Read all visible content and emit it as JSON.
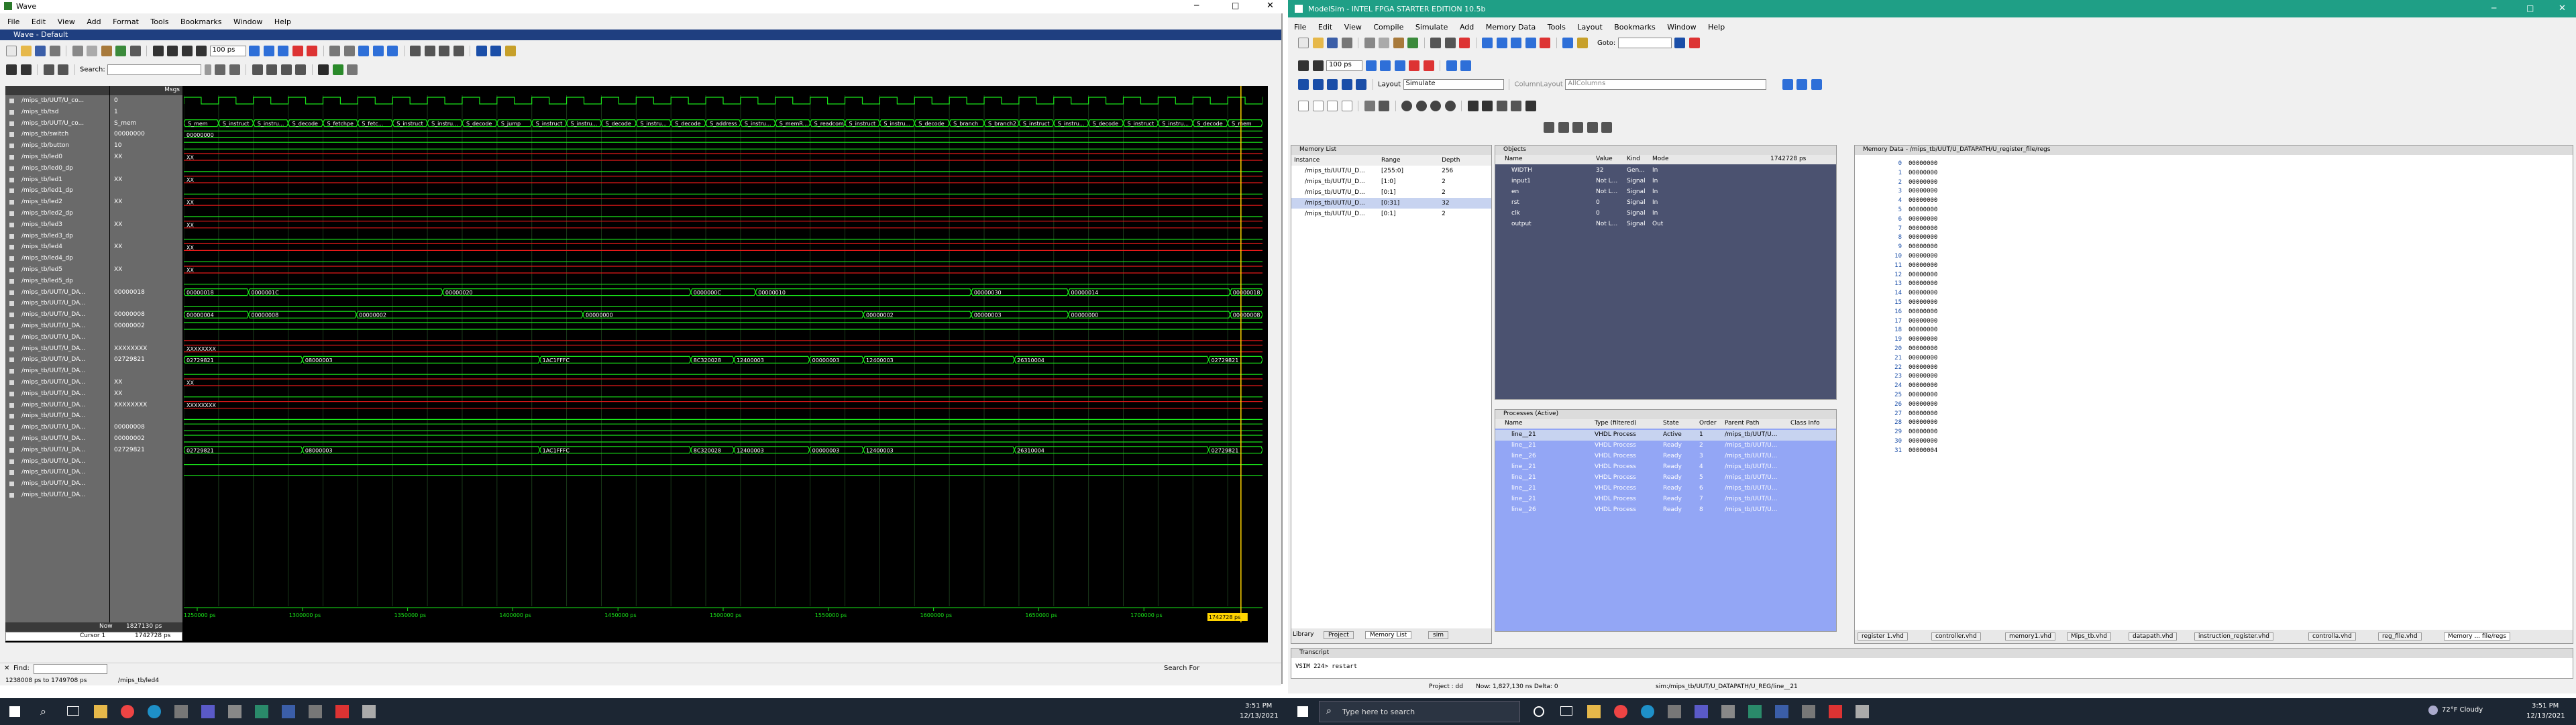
{
  "wave": {
    "title": "Wave",
    "menu": [
      "File",
      "Edit",
      "View",
      "Add",
      "Format",
      "Tools",
      "Bookmarks",
      "Window",
      "Help"
    ],
    "subtitle": "Wave - Default",
    "search_label": "Search:",
    "header_msgs": "Msgs",
    "time_field": "100 ps",
    "signals": [
      "/mips_tb/UUT/U_co...",
      "/mips_tb/tsd",
      "/mips_tb/UUT/U_co...",
      "/mips_tb/switch",
      "/mips_tb/button",
      "/mips_tb/led0",
      "/mips_tb/led0_dp",
      "/mips_tb/led1",
      "/mips_tb/led1_dp",
      "/mips_tb/led2",
      "/mips_tb/led2_dp",
      "/mips_tb/led3",
      "/mips_tb/led3_dp",
      "/mips_tb/led4",
      "/mips_tb/led4_dp",
      "/mips_tb/led5",
      "/mips_tb/led5_dp",
      "/mips_tb/UUT/U_DA...",
      "/mips_tb/UUT/U_DA...",
      "/mips_tb/UUT/U_DA...",
      "/mips_tb/UUT/U_DA...",
      "/mips_tb/UUT/U_DA...",
      "/mips_tb/UUT/U_DA...",
      "/mips_tb/UUT/U_DA...",
      "/mips_tb/UUT/U_DA...",
      "/mips_tb/UUT/U_DA...",
      "/mips_tb/UUT/U_DA...",
      "/mips_tb/UUT/U_DA...",
      "/mips_tb/UUT/U_DA...",
      "/mips_tb/UUT/U_DA...",
      "/mips_tb/UUT/U_DA...",
      "/mips_tb/UUT/U_DA...",
      "/mips_tb/UUT/U_DA...",
      "/mips_tb/UUT/U_DA...",
      "/mips_tb/UUT/U_DA...",
      "/mips_tb/UUT/U_DA..."
    ],
    "values": [
      "0",
      "1",
      "S_mem",
      "00000000",
      "10",
      "XX",
      "",
      "XX",
      "",
      "XX",
      "",
      "XX",
      "",
      "XX",
      "",
      "XX",
      "",
      "00000018",
      "",
      "00000008",
      "00000002",
      "",
      "XXXXXXXX",
      "02729821",
      "",
      "XX",
      "XX",
      "XXXXXXXX",
      "",
      "00000008",
      "00000002",
      "02729821",
      "",
      "",
      "",
      ""
    ],
    "state_labels": [
      "S_mem",
      "S_instruct",
      "S_instru...",
      "S_decode",
      "S_fetchpe",
      "S_fetc...",
      "S_instruct",
      "S_instru...",
      "S_decode",
      "S_jump",
      "S_instruct",
      "S_instru...",
      "S_decode",
      "S_instru...",
      "S_decode",
      "S_address",
      "S_instru...",
      "S_memR...",
      "S_readcom",
      "S_instruct",
      "S_instru...",
      "S_decode",
      "S_branch",
      "S_branch2",
      "S_instruct",
      "S_instru...",
      "S_decode",
      "S_instruct",
      "S_instru...",
      "S_decode",
      "S_mem"
    ],
    "bus1": [
      "00000018",
      "0000001C",
      "00000020",
      "0000000C",
      "00000010",
      "00000030",
      "00000014",
      "00000018"
    ],
    "bus2": [
      "00000004",
      "00000008",
      "00000002",
      "00000000",
      "00000002",
      "00000003",
      "00000000",
      "00000008"
    ],
    "bus3": [
      "02729821",
      "08000003",
      "1AC1FFFC",
      "8C320028",
      "12400003",
      "00000003",
      "12400003",
      "26310004",
      "02729821"
    ],
    "bus4": [
      "02729821",
      "08000003",
      "1AC1FFFC",
      "8C320028",
      "12400003",
      "00000003",
      "12400003",
      "26310004",
      "02729821"
    ],
    "now_label": "Now",
    "now_value": "1827130 ps",
    "cursor_label": "Cursor 1",
    "cursor_value": "1742728 ps",
    "ticks": [
      "1250000 ps",
      "1300000 ps",
      "1350000 ps",
      "1400000 ps",
      "1450000 ps",
      "1500000 ps",
      "1550000 ps",
      "1600000 ps",
      "1650000 ps",
      "1700000 ps"
    ],
    "cursor_flag": "1742728 ps",
    "status_range": "1238008 ps to 1749708 ps",
    "status_signal": "/mips_tb/led4",
    "find_label": "Find:",
    "search_for": "Search For"
  },
  "msim": {
    "title": "ModelSim - INTEL FPGA STARTER EDITION 10.5b",
    "menu": [
      "File",
      "Edit",
      "View",
      "Compile",
      "Simulate",
      "Add",
      "Memory Data",
      "Tools",
      "Layout",
      "Bookmarks",
      "Window",
      "Help"
    ],
    "goto_label": "Goto:",
    "layout_label": "Layout",
    "layout_value": "Simulate",
    "column_layout_label": "ColumnLayout",
    "column_layout_value": "AllColumns",
    "time_field": "100 ps",
    "memlist": {
      "title": "Memory List",
      "headers": [
        "Instance",
        "Range",
        "Depth"
      ],
      "rows": [
        [
          "/mips_tb/UUT/U_D...",
          "[255:0]",
          "256"
        ],
        [
          "/mips_tb/UUT/U_D...",
          "[1:0]",
          "2"
        ],
        [
          "/mips_tb/UUT/U_D...",
          "[0:1]",
          "2"
        ],
        [
          "/mips_tb/UUT/U_D...",
          "[0:31]",
          "32"
        ],
        [
          "/mips_tb/UUT/U_D...",
          "[0:1]",
          "2"
        ]
      ],
      "tabs": [
        "Library",
        "Project",
        "Memory List",
        "sim"
      ]
    },
    "objects": {
      "title": "Objects",
      "headers": [
        "Name",
        "Value",
        "Kind",
        "Mode"
      ],
      "time_label": "1742728 ps",
      "rows": [
        [
          "WIDTH",
          "32",
          "Gen...",
          "In"
        ],
        [
          "input1",
          "Not L...",
          "Signal",
          "In"
        ],
        [
          "en",
          "Not L...",
          "Signal",
          "In"
        ],
        [
          "rst",
          "0",
          "Signal",
          "In"
        ],
        [
          "clk",
          "0",
          "Signal",
          "In"
        ],
        [
          "output",
          "Not L...",
          "Signal",
          "Out"
        ]
      ]
    },
    "processes": {
      "title": "Processes (Active)",
      "headers": [
        "Name",
        "Type (filtered)",
        "State",
        "Order",
        "Parent Path",
        "Class Info"
      ],
      "rows": [
        [
          "line__21",
          "VHDL Process",
          "Active",
          "1",
          "/mips_tb/UUT/U..."
        ],
        [
          "line__21",
          "VHDL Process",
          "Ready",
          "2",
          "/mips_tb/UUT/U..."
        ],
        [
          "line__26",
          "VHDL Process",
          "Ready",
          "3",
          "/mips_tb/UUT/U..."
        ],
        [
          "line__21",
          "VHDL Process",
          "Ready",
          "4",
          "/mips_tb/UUT/U..."
        ],
        [
          "line__21",
          "VHDL Process",
          "Ready",
          "5",
          "/mips_tb/UUT/U..."
        ],
        [
          "line__21",
          "VHDL Process",
          "Ready",
          "6",
          "/mips_tb/UUT/U..."
        ],
        [
          "line__21",
          "VHDL Process",
          "Ready",
          "7",
          "/mips_tb/UUT/U..."
        ],
        [
          "line__26",
          "VHDL Process",
          "Ready",
          "8",
          "/mips_tb/UUT/U..."
        ]
      ]
    },
    "memdata": {
      "title": "Memory Data - /mips_tb/UUT/U_DATAPATH/U_register_file/regs",
      "addresses": [
        "0",
        "1",
        "2",
        "3",
        "4",
        "5",
        "6",
        "7",
        "8",
        "9",
        "10",
        "11",
        "12",
        "13",
        "14",
        "15",
        "16",
        "17",
        "18",
        "19",
        "20",
        "21",
        "22",
        "23",
        "24",
        "25",
        "26",
        "27",
        "28",
        "29",
        "30",
        "31"
      ],
      "values": [
        "00000000",
        "00000000",
        "00000000",
        "00000000",
        "00000000",
        "00000000",
        "00000000",
        "00000000",
        "00000000",
        "00000000",
        "00000000",
        "00000000",
        "00000000",
        "00000000",
        "00000000",
        "00000000",
        "00000000",
        "00000000",
        "00000000",
        "00000000",
        "00000000",
        "00000000",
        "00000000",
        "00000000",
        "00000000",
        "00000000",
        "00000000",
        "00000000",
        "00000000",
        "00000000",
        "00000000",
        "00000004"
      ],
      "tabs": [
        "register 1.vhd",
        "controller.vhd",
        "memory1.vhd",
        "Mips_tb.vhd",
        "datapath.vhd",
        "instruction_register.vhd",
        "controlla.vhd",
        "reg_file.vhd",
        "Memory ... file/regs"
      ]
    },
    "transcript": {
      "title": "Transcript",
      "line": "VSIM 224> restart"
    },
    "status": {
      "project": "Project : dd",
      "now": "Now: 1,827,130 ns  Delta: 0",
      "path": "sim:/mips_tb/UUT/U_DATAPATH/U_REG/line__21"
    }
  },
  "taskbar_left": {
    "time": "3:51 PM",
    "date": "12/13/2021"
  },
  "taskbar_right": {
    "search_placeholder": "Type here to search",
    "weather": "72°F  Cloudy",
    "time": "3:51 PM",
    "date": "12/13/2021"
  },
  "colors": {
    "wave_bg": "#000000",
    "signal_green": "#19e619",
    "signal_red": "#e61919",
    "cursor_yellow": "#ffd400",
    "objects_bg": "#4b5270",
    "processes_bg": "#93a6f5",
    "taskbar": "#1c2633"
  }
}
